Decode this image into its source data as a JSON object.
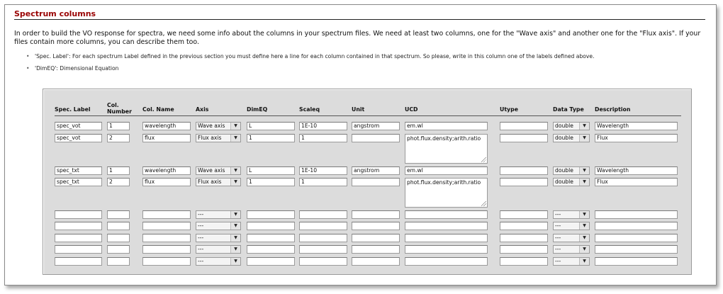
{
  "section": {
    "title": "Spectrum columns",
    "intro": "In order to build the VO response for spectra, we need some info about the columns in your spectrum files. We need at least two columns, one for the \"Wave axis\" and another one for the \"Flux axis\". If your files contain more columns, you can describe them too.",
    "notes": [
      "'Spec. Label': For each spectrum Label defined in the previous section you must define here a line for each column contained in that spectrum. So please, write in this column one of the labels defined above.",
      "'DimEQ': Dimensional Equation"
    ]
  },
  "table": {
    "headers": {
      "spec_label": "Spec. Label",
      "col_number_1": "Col.",
      "col_number_2": "Number",
      "col_name": "Col. Name",
      "axis": "Axis",
      "dimeq": "DimEQ",
      "scaleq": "Scaleq",
      "unit": "Unit",
      "ucd": "UCD",
      "utype": "Utype",
      "data_type": "Data Type",
      "description": "Description"
    },
    "rows": [
      {
        "spec_label": "spec_vot",
        "col_number": "1",
        "col_name": "wavelength",
        "axis": "Wave axis",
        "dimeq": "L",
        "scaleq": "1E-10",
        "unit": "angstrom",
        "ucd": "em.wl",
        "utype": "",
        "data_type": "double",
        "description": "Wavelength"
      },
      {
        "spec_label": "spec_vot",
        "col_number": "2",
        "col_name": "flux",
        "axis": "Flux axis",
        "dimeq": "1",
        "scaleq": "1",
        "unit": "",
        "ucd": "phot.flux.density;arith.ratio",
        "utype": "",
        "data_type": "double",
        "description": "Flux"
      },
      {
        "spec_label": "spec_txt",
        "col_number": "1",
        "col_name": "wavelength",
        "axis": "Wave axis",
        "dimeq": "L",
        "scaleq": "1E-10",
        "unit": "angstrom",
        "ucd": "em.wl",
        "utype": "",
        "data_type": "double",
        "description": "Wavelength"
      },
      {
        "spec_label": "spec_txt",
        "col_number": "2",
        "col_name": "flux",
        "axis": "Flux axis",
        "dimeq": "1",
        "scaleq": "1",
        "unit": "",
        "ucd": "phot.flux.density;arith.ratio",
        "utype": "",
        "data_type": "double",
        "description": "Flux"
      },
      {
        "spec_label": "",
        "col_number": "",
        "col_name": "",
        "axis": "---",
        "dimeq": "",
        "scaleq": "",
        "unit": "",
        "ucd": "",
        "utype": "",
        "data_type": "---",
        "description": ""
      },
      {
        "spec_label": "",
        "col_number": "",
        "col_name": "",
        "axis": "---",
        "dimeq": "",
        "scaleq": "",
        "unit": "",
        "ucd": "",
        "utype": "",
        "data_type": "---",
        "description": ""
      },
      {
        "spec_label": "",
        "col_number": "",
        "col_name": "",
        "axis": "---",
        "dimeq": "",
        "scaleq": "",
        "unit": "",
        "ucd": "",
        "utype": "",
        "data_type": "---",
        "description": ""
      },
      {
        "spec_label": "",
        "col_number": "",
        "col_name": "",
        "axis": "---",
        "dimeq": "",
        "scaleq": "",
        "unit": "",
        "ucd": "",
        "utype": "",
        "data_type": "---",
        "description": ""
      },
      {
        "spec_label": "",
        "col_number": "",
        "col_name": "",
        "axis": "---",
        "dimeq": "",
        "scaleq": "",
        "unit": "",
        "ucd": "",
        "utype": "",
        "data_type": "---",
        "description": ""
      }
    ]
  },
  "icons": {
    "dropdown": "chevron-down-icon",
    "resize": "resize-grip-icon",
    "bullet": "bullet-icon"
  },
  "colors": {
    "heading": "#990000",
    "panel": "#dcdcdc"
  }
}
